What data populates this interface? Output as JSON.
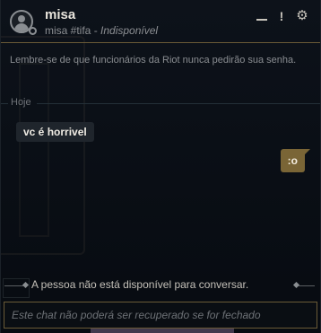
{
  "header": {
    "name": "misa",
    "tag": "misa #tifa",
    "separator": " - ",
    "status": "Indisponível",
    "controls": {
      "minimize": "",
      "report": "!",
      "settings": "⚙"
    }
  },
  "notice": "Lembre-se de que funcionários da Riot nunca pedirão sua senha.",
  "day_separator": "Hoje",
  "messages": [
    {
      "side": "incoming",
      "text": "vc é horrivel"
    },
    {
      "side": "outgoing",
      "text": ":o"
    }
  ],
  "unavailable_notice": "A pessoa não está disponível para conversar.",
  "input": {
    "placeholder": "Este chat não poderá ser recuperado se for fechado"
  },
  "colors": {
    "accent_gold": "#6a5a36",
    "outgoing_bubble": "#7a6536",
    "incoming_bubble": "#1f252c"
  }
}
